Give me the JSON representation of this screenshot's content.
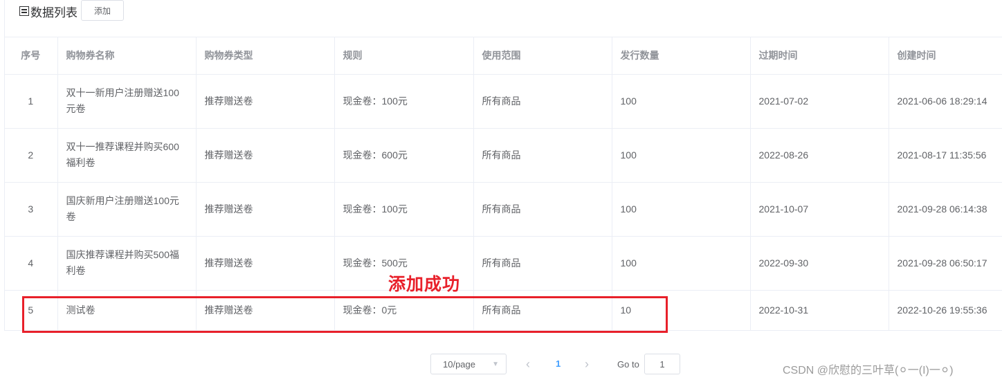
{
  "header": {
    "title": "数据列表",
    "add_label": "添加"
  },
  "table": {
    "columns": [
      "序号",
      "购物券名称",
      "购物券类型",
      "规则",
      "使用范围",
      "发行数量",
      "过期时间",
      "创建时间"
    ],
    "rows": [
      [
        "1",
        "双十一新用户注册赠送100元卷",
        "推荐赠送卷",
        "现金卷：100元",
        "所有商品",
        "100",
        "2021-07-02",
        "2021-06-06 18:29:14"
      ],
      [
        "2",
        "双十一推荐课程并购买600福利卷",
        "推荐赠送卷",
        "现金卷：600元",
        "所有商品",
        "100",
        "2022-08-26",
        "2021-08-17 11:35:56"
      ],
      [
        "3",
        "国庆新用户注册赠送100元卷",
        "推荐赠送卷",
        "现金卷：100元",
        "所有商品",
        "100",
        "2021-10-07",
        "2021-09-28 06:14:38"
      ],
      [
        "4",
        "国庆推荐课程并购买500福利卷",
        "推荐赠送卷",
        "现金卷：500元",
        "所有商品",
        "100",
        "2022-09-30",
        "2021-09-28 06:50:17"
      ],
      [
        "5",
        "测试卷",
        "推荐赠送卷",
        "现金卷：0元",
        "所有商品",
        "10",
        "2022-10-31",
        "2022-10-26 19:55:36"
      ]
    ]
  },
  "annotation": {
    "text": "添加成功",
    "color": "#e8202a"
  },
  "pagination": {
    "page_size": "10/page",
    "current_page": "1",
    "goto_label": "Go to",
    "goto_value": "1"
  },
  "watermark": "CSDN @欣慰的三叶草(⚪一(I)一⚪)",
  "colors": {
    "accent": "#409eff",
    "border": "#ebeef5",
    "header_text": "#909399"
  }
}
